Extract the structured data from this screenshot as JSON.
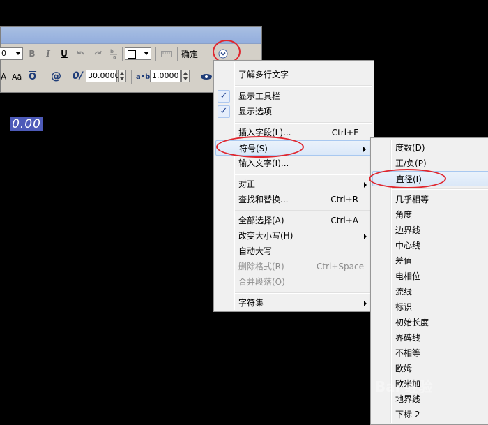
{
  "toolbar": {
    "font_size_value": "0",
    "bold_label": "B",
    "italic_label": "I",
    "underline_label": "U",
    "color_value": "",
    "ok_label": "确定",
    "row2_a_label": "A",
    "row2_aa_label": "Aā",
    "row2_o_label": "O",
    "at_label": "@",
    "oblique_label": "0/",
    "oblique_value": "30.0000",
    "tracking_label": "a•b",
    "tracking_value": "1.0000"
  },
  "editor": {
    "selected_text": "0.00"
  },
  "context_menu": {
    "items": [
      {
        "label": "了解多行文字"
      },
      {
        "label": "显示工具栏",
        "checked": true
      },
      {
        "label": "显示选项",
        "checked": true
      },
      {
        "label": "插入字段(L)...",
        "shortcut": "Ctrl+F"
      },
      {
        "label": "符号(S)",
        "submenu": true,
        "highlighted": true
      },
      {
        "label": "输入文字(I)..."
      },
      {
        "label": "对正",
        "submenu": true
      },
      {
        "label": "查找和替换...",
        "shortcut": "Ctrl+R"
      },
      {
        "label": "全部选择(A)",
        "shortcut": "Ctrl+A"
      },
      {
        "label": "改变大小写(H)",
        "submenu": true
      },
      {
        "label": "自动大写"
      },
      {
        "label": "删除格式(R)",
        "shortcut": "Ctrl+Space",
        "disabled": true
      },
      {
        "label": "合并段落(O)",
        "disabled": true
      },
      {
        "label": "字符集",
        "submenu": true
      }
    ]
  },
  "symbol_submenu": {
    "items": [
      "度数(D)",
      "正/负(P)",
      "直径(I)",
      "几乎相等",
      "角度",
      "边界线",
      "中心线",
      "差值",
      "电相位",
      "流线",
      "标识",
      "初始长度",
      "界碑线",
      "不相等",
      "欧姆",
      "欧米加",
      "地界线",
      "下标 2"
    ],
    "highlighted": "直径(I)"
  },
  "watermark": {
    "text": "Bai 经验"
  },
  "colors": {
    "highlight_ring": "#e0262e",
    "selection": "#4d5ab8"
  }
}
